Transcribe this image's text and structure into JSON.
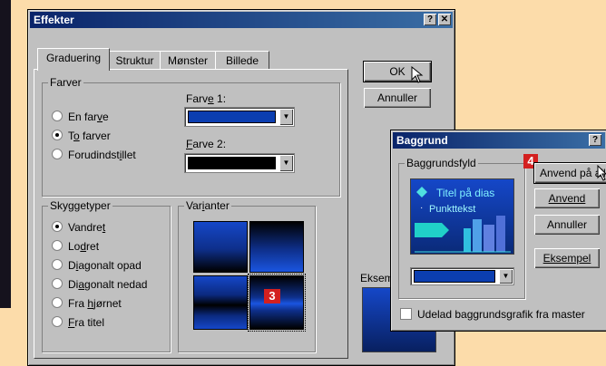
{
  "effekter": {
    "title": "Effekter",
    "help_btn": "?",
    "close_btn": "✕",
    "tabs": [
      {
        "label": "Graduering",
        "active": true
      },
      {
        "label": "Struktur",
        "active": false
      },
      {
        "label": "Mønster",
        "active": false
      },
      {
        "label": "Billede",
        "active": false
      }
    ],
    "farver_group": "Farver",
    "color_options": [
      {
        "pre": "En far",
        "u": "v",
        "post": "e",
        "selected": false
      },
      {
        "pre": "T",
        "u": "o",
        "post": " farver",
        "selected": true
      },
      {
        "pre": "Forudindst",
        "u": "i",
        "post": "llet",
        "selected": false
      }
    ],
    "farve1": {
      "pre": "Farv",
      "u": "e",
      "post": " 1:",
      "color": "#0b3eb0"
    },
    "farve2": {
      "pre": "",
      "u": "F",
      "post": "arve 2:",
      "color": "#000000"
    },
    "skygge_group": "Skyggetyper",
    "shade_options": [
      {
        "pre": "Vandre",
        "u": "t",
        "post": "",
        "selected": true
      },
      {
        "pre": "Lo",
        "u": "d",
        "post": "ret",
        "selected": false
      },
      {
        "pre": "D",
        "u": "i",
        "post": "agonalt opad",
        "selected": false
      },
      {
        "pre": "Di",
        "u": "a",
        "post": "gonalt nedad",
        "selected": false
      },
      {
        "pre": "Fra ",
        "u": "h",
        "post": "jørnet",
        "selected": false
      },
      {
        "pre": "",
        "u": "F",
        "post": "ra titel",
        "selected": false
      }
    ],
    "varianter_group": {
      "pre": "Var",
      "u": "i",
      "post": "anter"
    },
    "variant_badge": "3",
    "ok_label": "OK",
    "annuller_label": "Annuller",
    "eksempel_label": "Eksem"
  },
  "baggrund": {
    "title": "Baggrund",
    "help_btn": "?",
    "fyld_group": "Baggrundsfyld",
    "preview_title": "Titel på dias",
    "preview_bullet": "Punkttekst",
    "badge": "4",
    "anvend_alle_label": "Anvend på alle",
    "anvend_label": "Anvend",
    "annuller_label": "Annuller",
    "eksempel_label": "Eksempel",
    "checkbox_label": "Udelad baggrundsgrafik fra master"
  },
  "colors": {
    "accent_blue": "#0b3eb0",
    "titlebar": "#0a246a",
    "badge_red": "#d32020"
  }
}
